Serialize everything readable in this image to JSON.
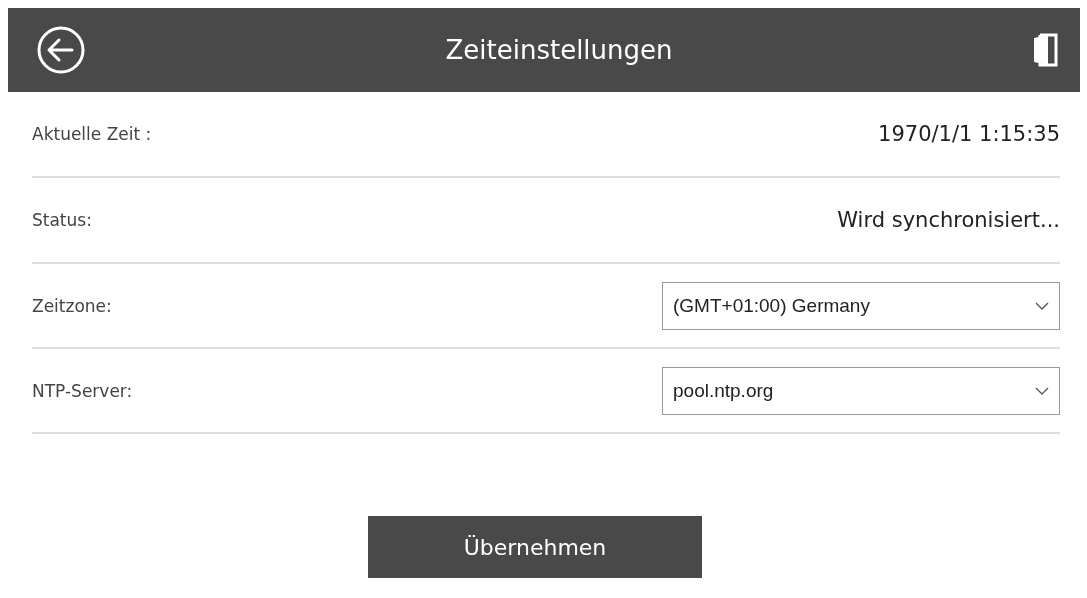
{
  "header": {
    "title": "Zeiteinstellungen"
  },
  "rows": [
    {
      "kind": "text",
      "label": "Aktuelle Zeit :",
      "value": "1970/1/1 1:15:35"
    },
    {
      "kind": "text",
      "label": "Status:",
      "value": "Wird synchronisiert..."
    },
    {
      "kind": "select",
      "label": "Zeitzone:",
      "value": "(GMT+01:00) Germany"
    },
    {
      "kind": "select",
      "label": "NTP-Server:",
      "value": "pool.ntp.org"
    }
  ],
  "apply_button": "Übernehmen"
}
